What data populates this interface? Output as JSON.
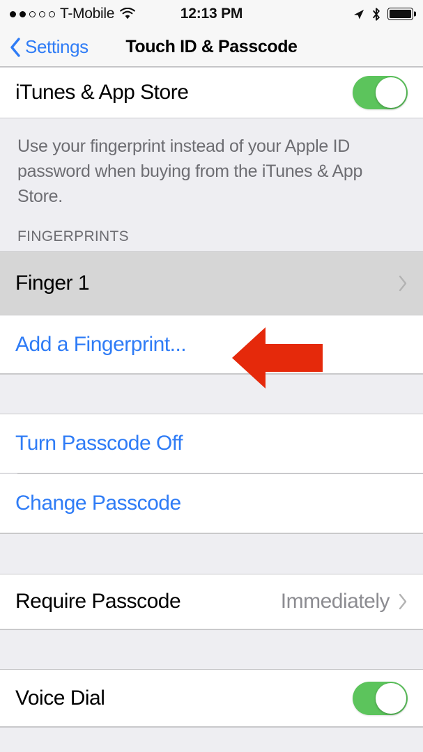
{
  "status_bar": {
    "signal_dots_total": 5,
    "signal_dots_filled": 2,
    "carrier": "T-Mobile",
    "wifi_icon": "wifi-icon",
    "time": "12:13 PM",
    "location_icon": "location-arrow-icon",
    "bluetooth_icon": "bluetooth-icon",
    "battery_icon": "battery-full-icon",
    "battery_level_percent": 100
  },
  "nav_bar": {
    "back_icon": "chevron-left-icon",
    "back_label": "Settings",
    "title": "Touch ID & Passcode"
  },
  "sections": {
    "itunes": {
      "label": "iTunes & App Store",
      "toggle_state": "on",
      "footer": "Use your fingerprint instead of your Apple ID password when buying from the iTunes & App Store."
    },
    "fingerprints": {
      "header": "FINGERPRINTS",
      "finger_1": {
        "label": "Finger 1",
        "chevron_icon": "chevron-right-icon",
        "state": "pressed"
      },
      "add_fingerprint": {
        "label": "Add a Fingerprint..."
      }
    },
    "passcode": {
      "turn_off": "Turn Passcode Off",
      "change": "Change Passcode"
    },
    "require": {
      "label": "Require Passcode",
      "value": "Immediately",
      "chevron_icon": "chevron-right-icon"
    },
    "voice_dial": {
      "label": "Voice Dial",
      "toggle_state": "on"
    }
  },
  "annotation": {
    "arrow_icon": "left-arrow-annotation",
    "color": "#e5290b",
    "points_to": "Add a Fingerprint..."
  },
  "colors": {
    "accent_blue": "#2f7cf6",
    "toggle_green": "#5cc45c",
    "group_background": "#eeeef2",
    "row_background": "#ffffff",
    "pressed_row": "#d6d6d6",
    "secondary_text": "#6d6d72",
    "value_text": "#8c8c91",
    "annotation_red": "#e5290b"
  }
}
